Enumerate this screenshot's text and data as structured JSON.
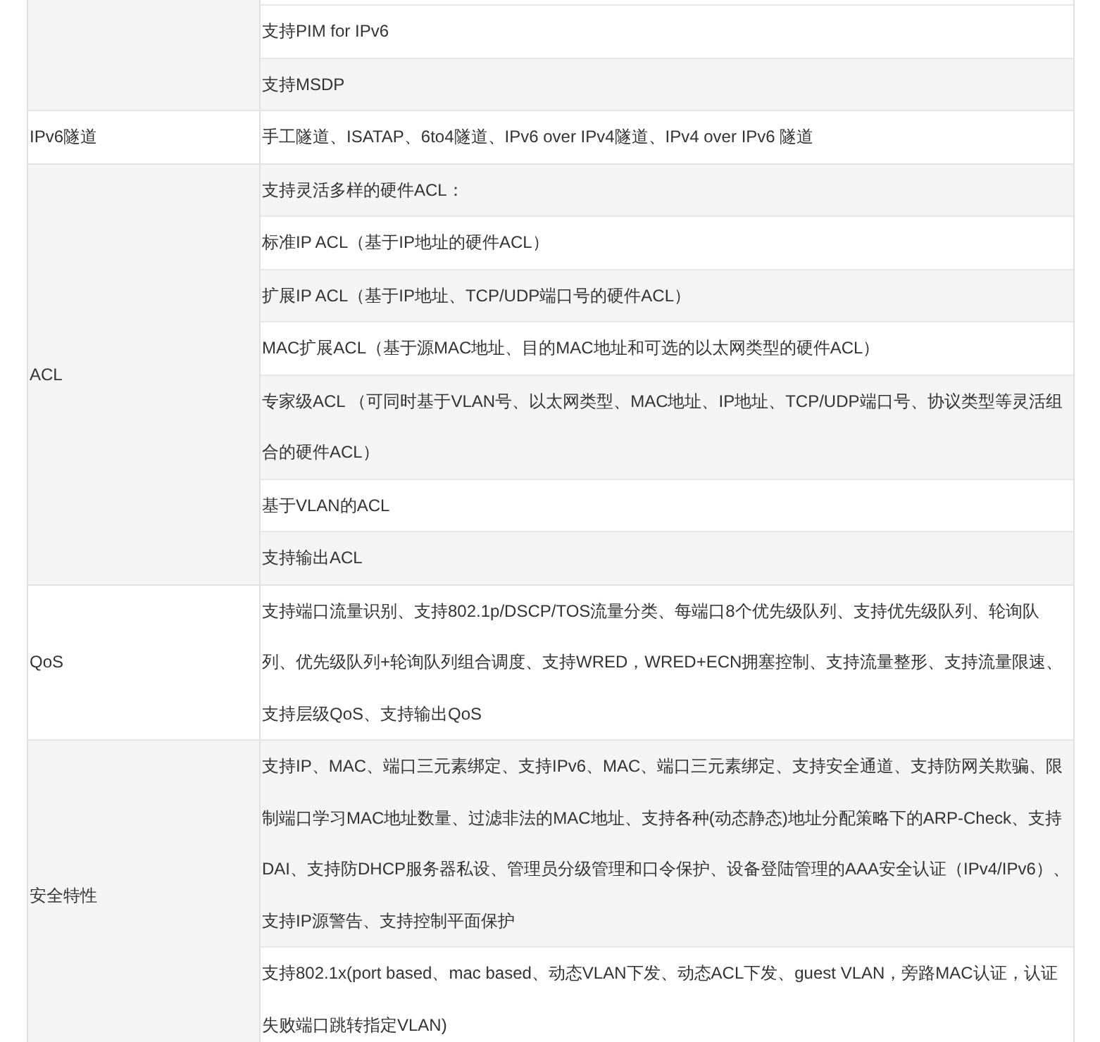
{
  "groups": [
    {
      "rows": [
        "支持PIM for IPv6",
        "支持MSDP"
      ]
    },
    {
      "label": "IPv6隧道",
      "rows": [
        "手工隧道、ISATAP、6to4隧道、IPv6 over IPv4隧道、IPv4 over IPv6 隧道"
      ]
    },
    {
      "label": "ACL",
      "rows": [
        "支持灵活多样的硬件ACL：",
        "标准IP ACL（基于IP地址的硬件ACL）",
        "扩展IP ACL（基于IP地址、TCP/UDP端口号的硬件ACL）",
        "MAC扩展ACL（基于源MAC地址、目的MAC地址和可选的以太网类型的硬件ACL）",
        "专家级ACL （可同时基于VLAN号、以太网类型、MAC地址、IP地址、TCP/UDP端口号、协议类型等灵活组合的硬件ACL）",
        "基于VLAN的ACL",
        "支持输出ACL"
      ]
    },
    {
      "label": "QoS",
      "rows": [
        "支持端口流量识别、支持802.1p/DSCP/TOS流量分类、每端口8个优先级队列、支持优先级队列、轮询队列、优先级队列+轮询队列组合调度、支持WRED，WRED+ECN拥塞控制、支持流量整形、支持流量限速、支持层级QoS、支持输出QoS"
      ]
    },
    {
      "label": "安全特性",
      "rows": [
        "支持IP、MAC、端口三元素绑定、支持IPv6、MAC、端口三元素绑定、支持安全通道、支持防网关欺骗、限制端口学习MAC地址数量、过滤非法的MAC地址、支持各种(动态静态)地址分配策略下的ARP-Check、支持DAI、支持防DHCP服务器私设、管理员分级管理和口令保护、设备登陆管理的AAA安全认证（IPv4/IPv6）、支持IP源警告、支持控制平面保护",
        "支持802.1x(port based、mac based、动态VLAN下发、动态ACL下发、guest VLAN，旁路MAC认证，认证失败端口跳转指定VLAN)"
      ]
    }
  ]
}
